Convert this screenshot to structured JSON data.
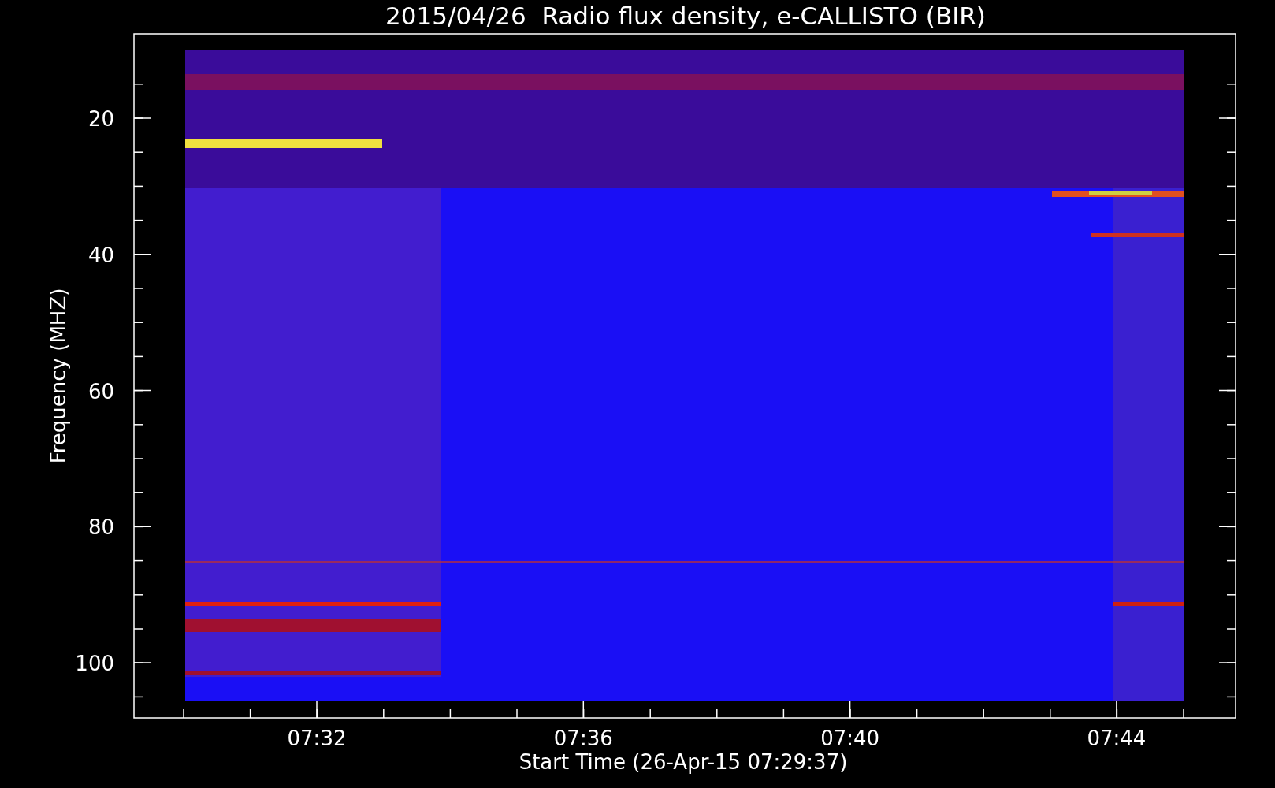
{
  "title": "2015/04/26  Radio flux density, e-CALLISTO (BIR)",
  "y_axis": {
    "label": "Frequency (MHZ)",
    "ticks": [
      "20",
      "40",
      "60",
      "80",
      "100"
    ]
  },
  "x_axis": {
    "label": "Start Time (26-Apr-15 07:29:37)",
    "ticks": [
      "07:32",
      "07:36",
      "07:40",
      "07:44"
    ]
  }
}
